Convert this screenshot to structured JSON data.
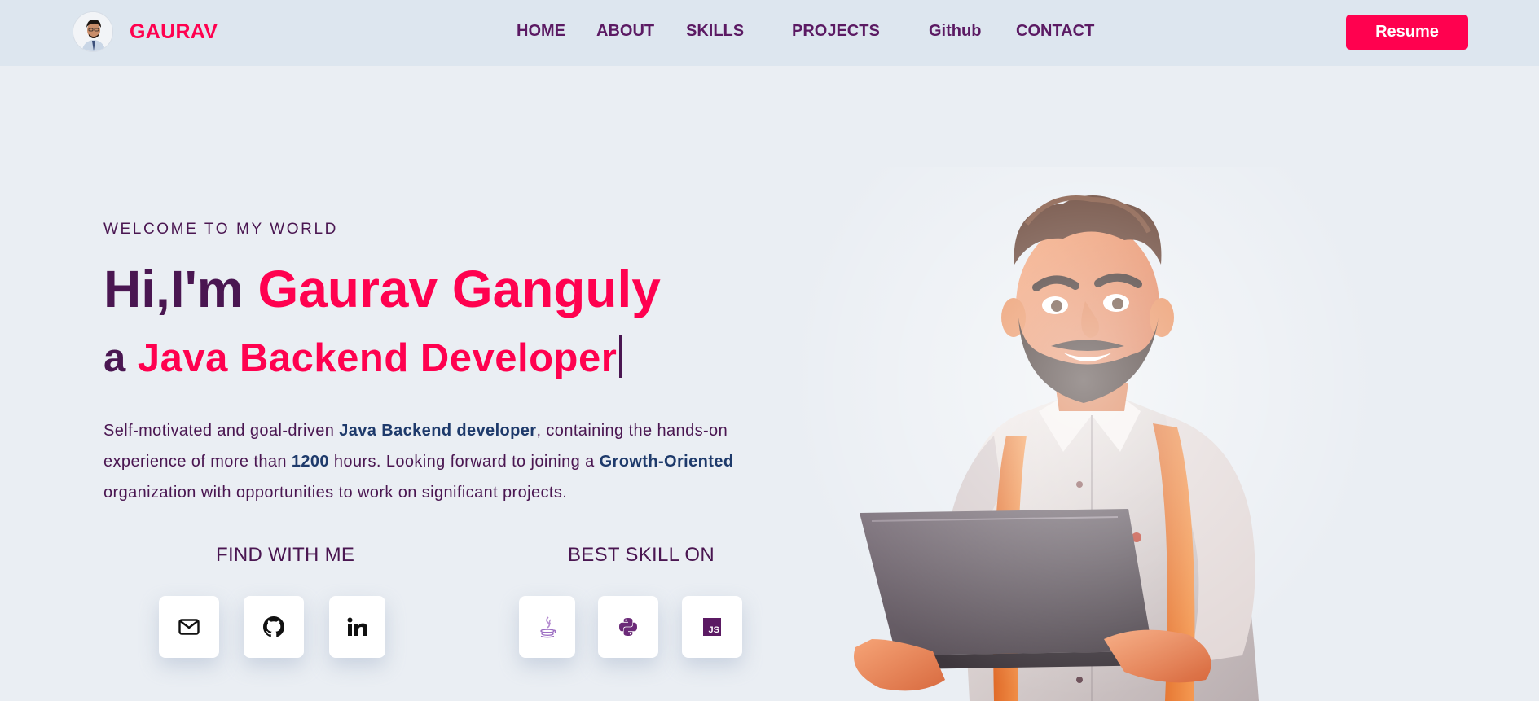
{
  "header": {
    "brand": "GAURAV",
    "nav": {
      "home": "HOME",
      "about": "ABOUT",
      "skills": "SKILLS",
      "projects": "PROJECTS",
      "github": "Github",
      "contact": "CONTACT"
    },
    "resume_label": "Resume"
  },
  "hero": {
    "welcome": "WELCOME TO MY WORLD",
    "greeting": "Hi,I'm ",
    "name": "Gaurav Ganguly",
    "role_prefix": "a ",
    "role": "Java Backend Developer",
    "description": {
      "part1": "Self-motivated and goal-driven ",
      "bold1": "Java Backend developer",
      "part2": ", containing the hands-on experience of more than ",
      "bold2": "1200",
      "part3": " hours. Looking forward to joining a ",
      "bold3": "Growth-Oriented",
      "part4": " organization with opportunities to work on significant projects."
    },
    "find_with_me": "FIND WITH ME",
    "best_skill_on": "BEST SKILL ON",
    "social_icons": [
      "mail-icon",
      "github-icon",
      "linkedin-icon"
    ],
    "skill_icons": [
      "java-icon",
      "python-icon",
      "javascript-icon"
    ],
    "js_badge": "JS"
  },
  "colors": {
    "accent": "#ff014f",
    "primary_text": "#4a1651",
    "bold_text": "#1e3a6b",
    "nav_bg": "#dde6ef",
    "page_bg": "#eaeef3"
  }
}
